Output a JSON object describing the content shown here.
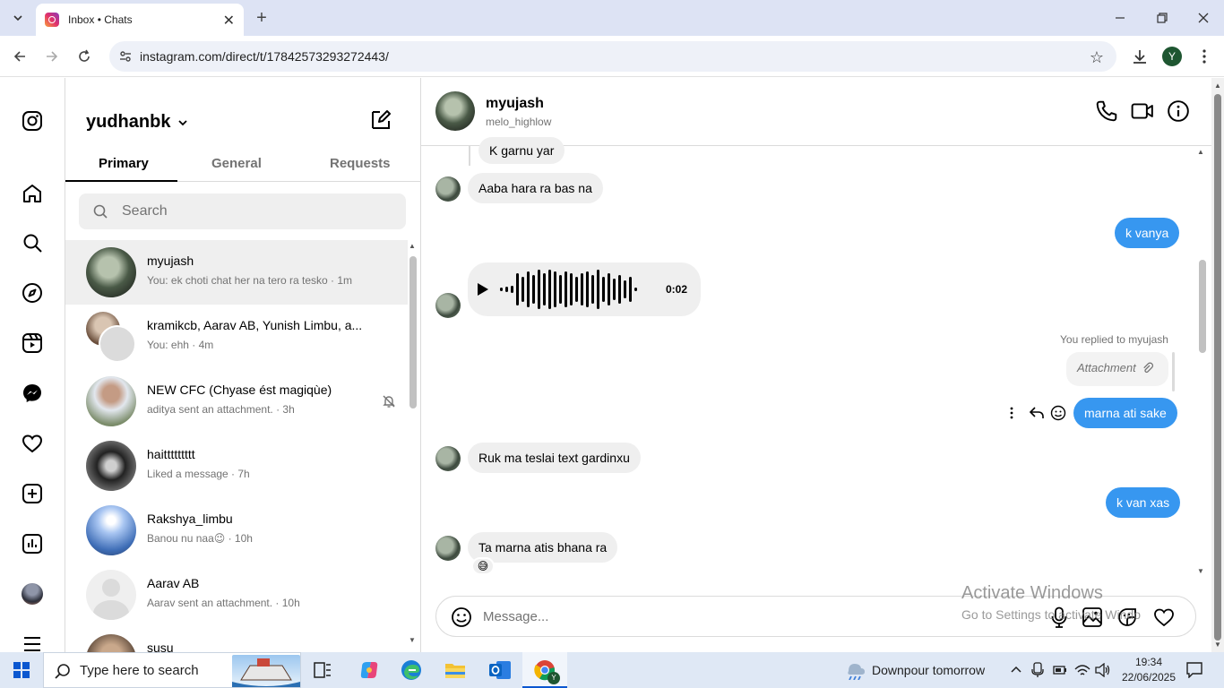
{
  "browser": {
    "tab_title": "Inbox • Chats",
    "url": "instagram.com/direct/t/17842573293272443/",
    "profile_initial": "Y"
  },
  "inbox": {
    "username": "yudhanbk",
    "tabs": [
      "Primary",
      "General",
      "Requests"
    ],
    "search_placeholder": "Search",
    "conversations": [
      {
        "name": "myujash",
        "preview": "You: ek choti chat her na tero ra tesko · 1m"
      },
      {
        "name": "kramikcb, Aarav AB, Yunish Limbu, a...",
        "preview": "You: ehh · 4m"
      },
      {
        "name": "NEW CFC (Chyase ést magiqùe)",
        "preview": "aditya sent an attachment. · 3h"
      },
      {
        "name": "haittttttttt",
        "preview": "Liked a message · 7h"
      },
      {
        "name": "Rakshya_limbu",
        "preview": "Banou nu naa😉 · 10h"
      },
      {
        "name": "Aarav AB",
        "preview": "Aarav sent an attachment. · 10h"
      },
      {
        "name": "susu",
        "preview": ""
      }
    ]
  },
  "chat": {
    "name": "myujash",
    "handle": "melo_highlow",
    "messages": {
      "m1": "K garnu yar",
      "m2": "Aaba hara ra bas na",
      "m3": "k vanya",
      "voice_duration": "0:02",
      "replied_label": "You replied to myujash",
      "attachment": "Attachment",
      "m4": "marna ati sake",
      "m5": "Ruk ma teslai text gardinxu",
      "m6": "k van xas",
      "m7": "Ta marna atis bhana ra",
      "reaction": "😅"
    },
    "composer_placeholder": "Message..."
  },
  "watermark": {
    "line1": "Activate Windows",
    "line2": "Go to Settings to activate Windows."
  },
  "taskbar": {
    "search_placeholder": "Type here to search",
    "weather": "Downpour tomorrow",
    "time": "19:34",
    "date": "22/06/2025"
  }
}
